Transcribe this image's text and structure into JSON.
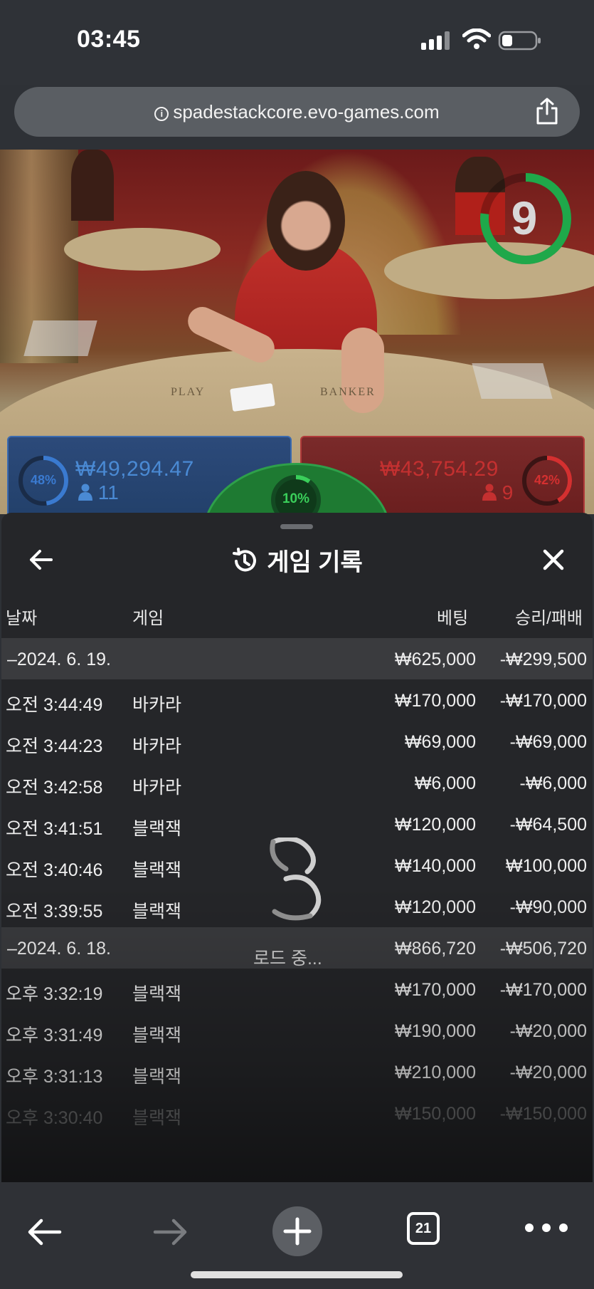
{
  "status": {
    "time": "03:45"
  },
  "browser": {
    "url": "spadestackcore.evo-games.com",
    "tab_count": "21"
  },
  "game": {
    "timer": "9",
    "player": {
      "percent": "48%",
      "amount": "₩49,294.47",
      "players": "11",
      "color": "#3a7ad0"
    },
    "banker": {
      "percent": "42%",
      "amount": "₩43,754.29",
      "players": "9",
      "color": "#c43030"
    },
    "tie": {
      "percent": "10%",
      "color": "#2ea04a"
    },
    "felt_player": "PLAY",
    "felt_banker": "BANKER"
  },
  "sheet": {
    "title": "게임 기록",
    "columns": {
      "date": "날짜",
      "game": "게임",
      "bet": "베팅",
      "result": "승리/패배"
    },
    "loading_text": "로드 중...",
    "groups": [
      {
        "date": "–2024. 6. 19.",
        "bet": "₩625,000",
        "result": "-₩299,500",
        "rows": [
          {
            "time": "오전 3:44:49",
            "game": "바카라",
            "bet": "₩170,000",
            "result": "-₩170,000"
          },
          {
            "time": "오전 3:44:23",
            "game": "바카라",
            "bet": "₩69,000",
            "result": "-₩69,000"
          },
          {
            "time": "오전 3:42:58",
            "game": "바카라",
            "bet": "₩6,000",
            "result": "-₩6,000"
          },
          {
            "time": "오전 3:41:51",
            "game": "블랙잭",
            "bet": "₩120,000",
            "result": "-₩64,500"
          },
          {
            "time": "오전 3:40:46",
            "game": "블랙잭",
            "bet": "₩140,000",
            "result": "₩100,000"
          },
          {
            "time": "오전 3:39:55",
            "game": "블랙잭",
            "bet": "₩120,000",
            "result": "-₩90,000"
          }
        ]
      },
      {
        "date": "–2024. 6. 18.",
        "bet": "₩866,720",
        "result": "-₩506,720",
        "rows": [
          {
            "time": "오후 3:32:19",
            "game": "블랙잭",
            "bet": "₩170,000",
            "result": "-₩170,000"
          },
          {
            "time": "오후 3:31:49",
            "game": "블랙잭",
            "bet": "₩190,000",
            "result": "-₩20,000"
          },
          {
            "time": "오후 3:31:13",
            "game": "블랙잭",
            "bet": "₩210,000",
            "result": "-₩20,000"
          },
          {
            "time": "오후 3:30:40",
            "game": "블랙잭",
            "bet": "₩150,000",
            "result": "-₩150,000"
          }
        ]
      }
    ]
  },
  "icons": {
    "back": "arrow-left-icon",
    "close": "close-icon",
    "history": "history-icon",
    "share": "share-icon",
    "plus": "plus-icon",
    "forward": "arrow-right-icon",
    "more": "more-icon"
  }
}
